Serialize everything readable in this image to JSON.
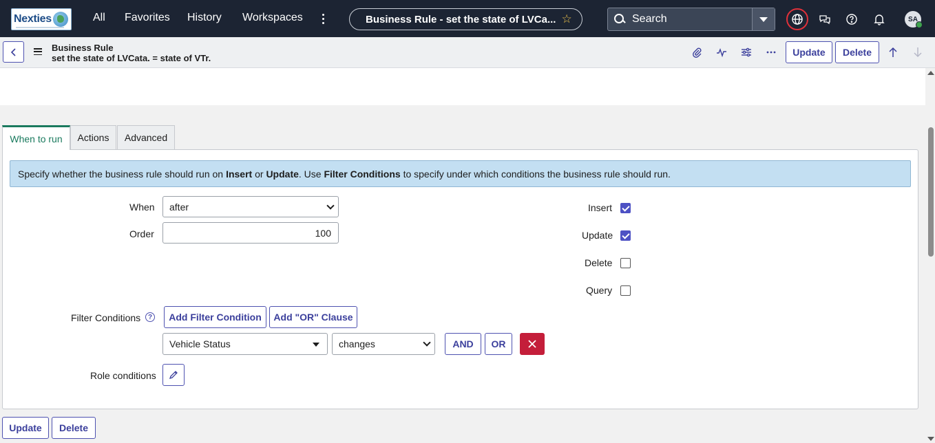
{
  "nav": {
    "logo_text": "Nexties",
    "links": [
      "All",
      "Favorites",
      "History",
      "Workspaces"
    ],
    "context_title": "Business Rule - set the state of LVCa...",
    "search_placeholder": "Search",
    "avatar_initials": "SA"
  },
  "header": {
    "record_type": "Business Rule",
    "record_name": "set the state of LVCata. = state of VTr.",
    "update_label": "Update",
    "delete_label": "Delete"
  },
  "tabs": [
    "When to run",
    "Actions",
    "Advanced"
  ],
  "info": {
    "part1": "Specify whether the business rule should run on ",
    "insert": "Insert",
    "or": " or ",
    "update": "Update",
    "part2": ". Use ",
    "filter": "Filter Conditions",
    "part3": " to specify under which conditions the business rule should run."
  },
  "form": {
    "when_label": "When",
    "when_value": "after",
    "order_label": "Order",
    "order_value": "100",
    "insert_label": "Insert",
    "insert_checked": true,
    "update_label": "Update",
    "update_checked": true,
    "delete_label": "Delete",
    "delete_checked": false,
    "query_label": "Query",
    "query_checked": false,
    "filter_label": "Filter Conditions",
    "add_filter_label": "Add Filter Condition",
    "add_or_label": "Add \"OR\" Clause",
    "condition_field": "Vehicle Status",
    "condition_operator": "changes",
    "and_label": "AND",
    "or_label": "OR",
    "role_label": "Role conditions"
  },
  "footer": {
    "update_label": "Update",
    "delete_label": "Delete"
  },
  "colors": {
    "nav_bg": "#1c2433",
    "accent": "#4d51b0",
    "tab_active": "#1a7a5e",
    "info_bg": "#c3dff2",
    "danger": "#c41e3a"
  }
}
